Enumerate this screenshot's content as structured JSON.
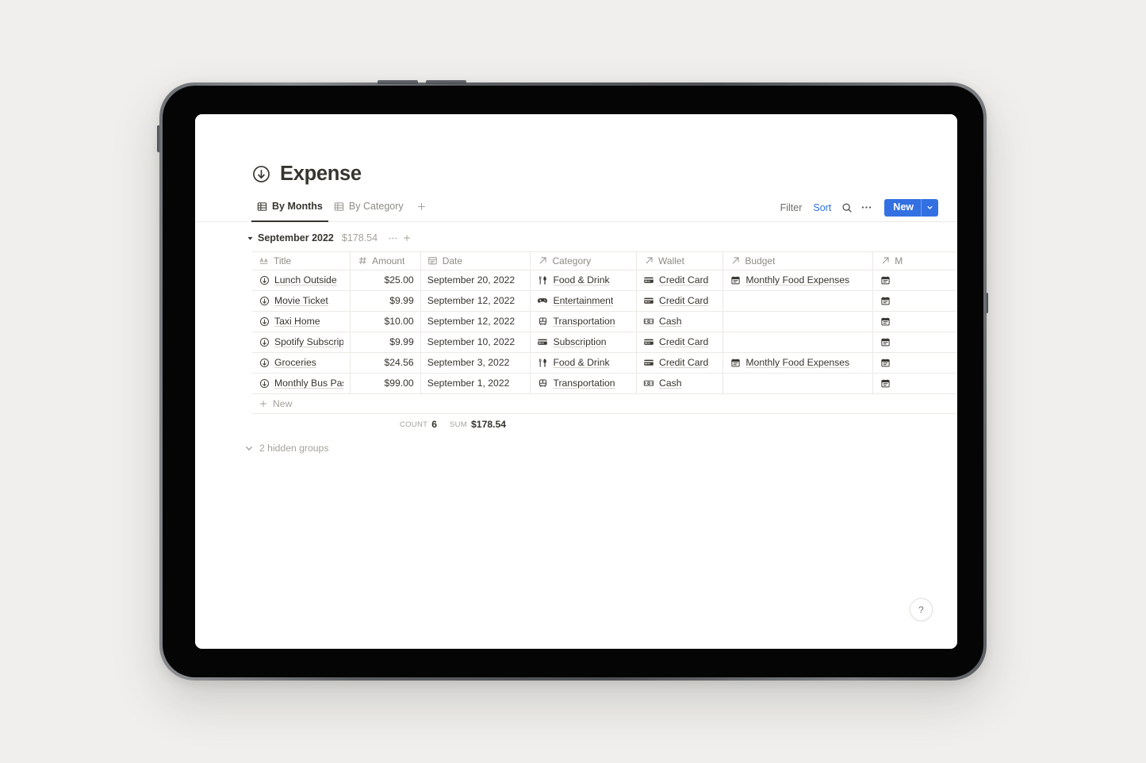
{
  "page": {
    "title": "Expense",
    "icon": "circle-down-arrow-icon"
  },
  "views": {
    "tabs": [
      {
        "label": "By Months",
        "icon": "table-icon",
        "active": true
      },
      {
        "label": "By Category",
        "icon": "table-icon",
        "active": false
      }
    ],
    "add_view_label": "+"
  },
  "toolbar": {
    "filter_label": "Filter",
    "sort_label": "Sort",
    "search_icon": "search-icon",
    "more_icon": "ellipsis-icon",
    "new_label": "New",
    "new_dropdown_icon": "chevron-down-icon",
    "accent_color": "#2f6fe0",
    "new_button_color": "#3370e2"
  },
  "group": {
    "collapse_icon": "triangle-down-icon",
    "name": "September 2022",
    "total": "$178.54",
    "menu_icon": "ellipsis-icon",
    "add_icon": "plus-icon"
  },
  "table": {
    "columns": [
      {
        "key": "title",
        "label": "Title",
        "icon": "text-aa-icon"
      },
      {
        "key": "amount",
        "label": "Amount",
        "icon": "number-hash-icon"
      },
      {
        "key": "date",
        "label": "Date",
        "icon": "calendar-icon"
      },
      {
        "key": "category",
        "label": "Category",
        "icon": "relation-arrow-icon"
      },
      {
        "key": "wallet",
        "label": "Wallet",
        "icon": "relation-arrow-icon"
      },
      {
        "key": "budget",
        "label": "Budget",
        "icon": "relation-arrow-icon"
      },
      {
        "key": "more",
        "label": "M",
        "icon": "relation-arrow-icon"
      }
    ],
    "rows": [
      {
        "title": "Lunch Outside",
        "title_icon": "circle-down-arrow-icon",
        "amount": "$25.00",
        "date": "September 20, 2022",
        "category": "Food & Drink",
        "category_icon": "cutlery-icon",
        "wallet": "Credit Card",
        "wallet_icon": "credit-card-icon",
        "budget": "Monthly Food Expenses",
        "budget_icon": "calendar-page-icon",
        "more": "",
        "more_icon": "calendar-page-icon"
      },
      {
        "title": "Movie Ticket",
        "title_icon": "circle-down-arrow-icon",
        "amount": "$9.99",
        "date": "September 12, 2022",
        "category": "Entertainment",
        "category_icon": "game-controller-icon",
        "wallet": "Credit Card",
        "wallet_icon": "credit-card-icon",
        "budget": "",
        "budget_icon": "",
        "more": "",
        "more_icon": "calendar-page-icon"
      },
      {
        "title": "Taxi Home",
        "title_icon": "circle-down-arrow-icon",
        "amount": "$10.00",
        "date": "September 12, 2022",
        "category": "Transportation",
        "category_icon": "bus-icon",
        "wallet": "Cash",
        "wallet_icon": "banknote-icon",
        "budget": "",
        "budget_icon": "",
        "more": "",
        "more_icon": "calendar-page-icon"
      },
      {
        "title": "Spotify Subscription",
        "title_icon": "circle-down-arrow-icon",
        "amount": "$9.99",
        "date": "September 10, 2022",
        "category": "Subscription",
        "category_icon": "credit-card-icon",
        "wallet": "Credit Card",
        "wallet_icon": "credit-card-icon",
        "budget": "",
        "budget_icon": "",
        "more": "",
        "more_icon": "calendar-page-icon"
      },
      {
        "title": "Groceries",
        "title_icon": "circle-down-arrow-icon",
        "amount": "$24.56",
        "date": "September 3, 2022",
        "category": "Food & Drink",
        "category_icon": "cutlery-icon",
        "wallet": "Credit Card",
        "wallet_icon": "credit-card-icon",
        "budget": "Monthly Food Expenses",
        "budget_icon": "calendar-page-icon",
        "more": "",
        "more_icon": "calendar-page-icon"
      },
      {
        "title": "Monthly Bus Pass",
        "title_icon": "circle-down-arrow-icon",
        "amount": "$99.00",
        "date": "September 1, 2022",
        "category": "Transportation",
        "category_icon": "bus-icon",
        "wallet": "Cash",
        "wallet_icon": "banknote-icon",
        "budget": "",
        "budget_icon": "",
        "more": "",
        "more_icon": "calendar-page-icon"
      }
    ],
    "new_row_label": "New",
    "aggregates": {
      "count_label": "Count",
      "count_value": "6",
      "sum_label": "Sum",
      "sum_value": "$178.54"
    }
  },
  "hidden_groups": {
    "label": "2 hidden groups",
    "icon": "chevron-down-icon"
  },
  "help": {
    "label": "?"
  }
}
